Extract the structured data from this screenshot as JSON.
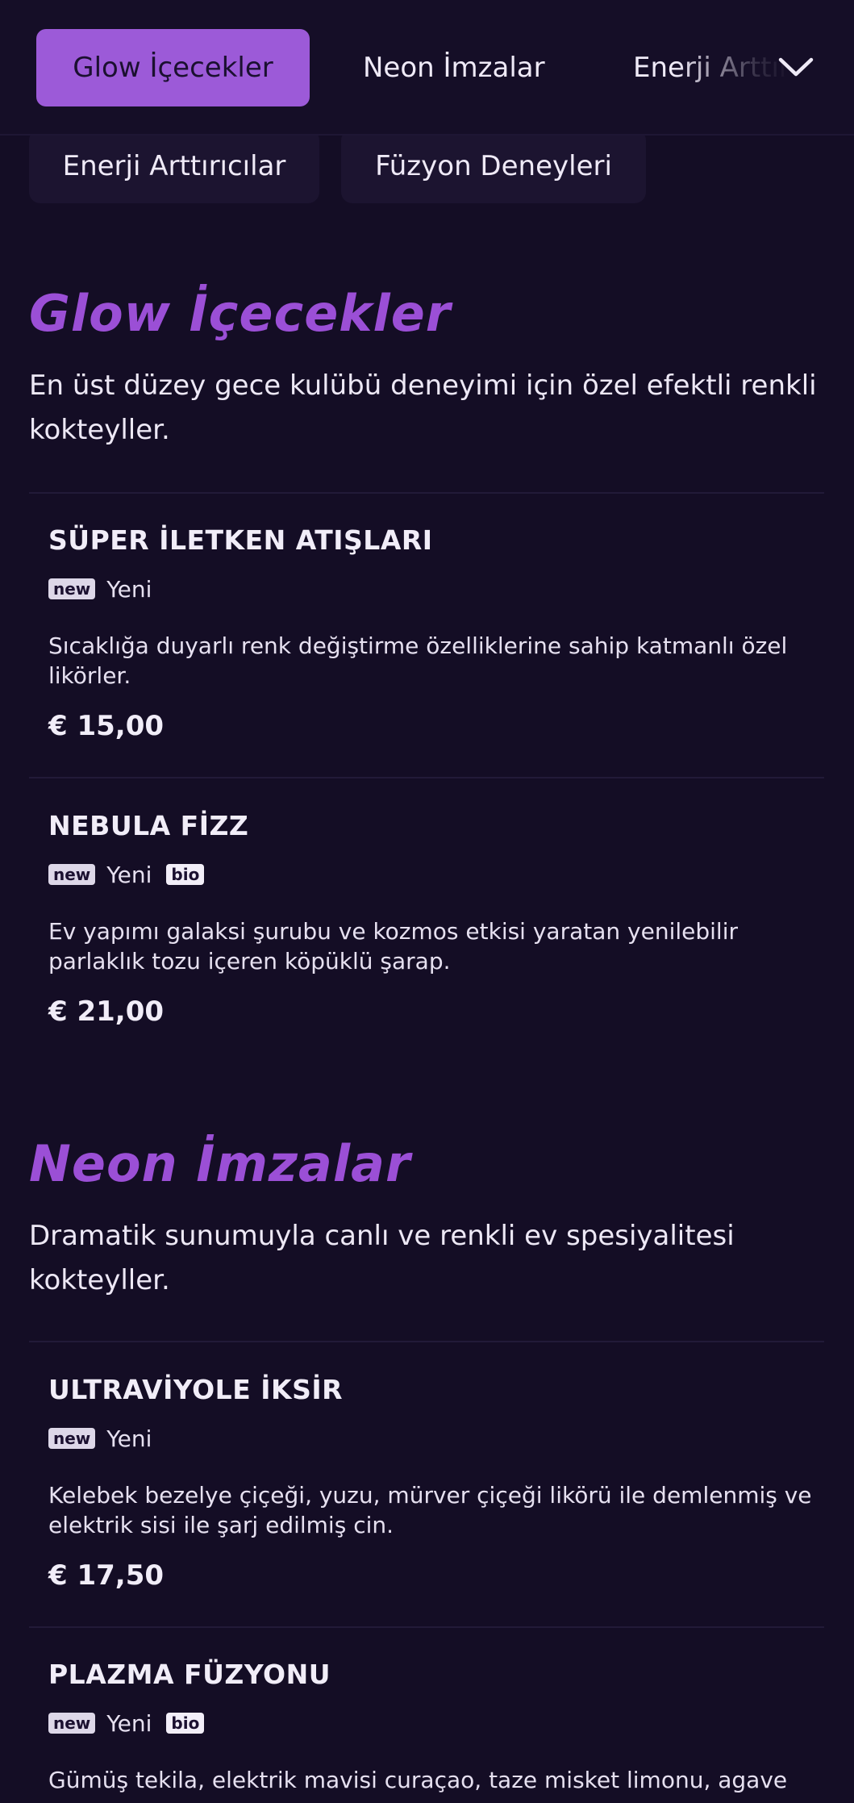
{
  "nav": {
    "tabs": [
      "Glow İçecekler",
      "Neon İmzalar",
      "Enerji Arttırıcılar"
    ],
    "active_index": 0,
    "pills": [
      "Enerji Arttırıcılar",
      "Füzyon Deneyleri"
    ],
    "expand_icon": "chevron-down-icon"
  },
  "sections": [
    {
      "title": "Glow İçecekler",
      "description": "En üst düzey gece kulübü deneyimi için özel efektli renkli kokteyller.",
      "items": [
        {
          "name": "SÜPER İLETKEN ATIŞLARI",
          "badge_new": "new",
          "tag_label": "Yeni",
          "badge_bio": "",
          "description": "Sıcaklığa duyarlı renk değiştirme özelliklerine sahip katmanlı özel likörler.",
          "price": "€ 15,00"
        },
        {
          "name": "NEBULA FİZZ",
          "badge_new": "new",
          "tag_label": "Yeni",
          "badge_bio": "bio",
          "description": "Ev yapımı galaksi şurubu ve kozmos etkisi yaratan yenilebilir parlaklık tozu içeren köpüklü şarap.",
          "price": "€ 21,00"
        }
      ]
    },
    {
      "title": "Neon İmzalar",
      "description": "Dramatik sunumuyla canlı ve renkli ev spesiyalitesi kokteyller.",
      "items": [
        {
          "name": "ULTRAVİYOLE İKSİR",
          "badge_new": "new",
          "tag_label": "Yeni",
          "badge_bio": "",
          "description": "Kelebek bezelye çiçeği, yuzu, mürver çiçeği likörü ile demlenmiş ve elektrik sisi ile şarj edilmiş cin.",
          "price": "€ 17,50"
        },
        {
          "name": "PLAZMA FÜZYONU",
          "badge_new": "new",
          "tag_label": "Yeni",
          "badge_bio": "bio",
          "description": "Gümüş tekila, elektrik mavisi curaçao, taze misket limonu, agave",
          "price": ""
        }
      ]
    }
  ],
  "colors": {
    "background": "#140d25",
    "accent": "#9c5ad8",
    "section_title": "#9b4fd6"
  }
}
